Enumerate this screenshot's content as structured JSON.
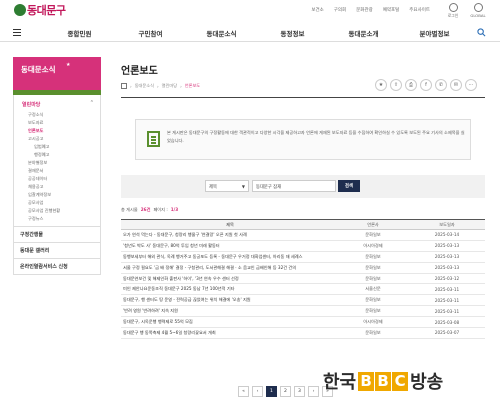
{
  "header": {
    "logo_text": "동대문구",
    "util_links": [
      "보건소",
      "구의회",
      "문화관광",
      "예약포털",
      "주요사이트"
    ],
    "util_icons": [
      {
        "name": "login-icon",
        "label": "로그인"
      },
      {
        "name": "global-icon",
        "label": "GLOBAL"
      }
    ]
  },
  "nav": {
    "items": [
      "종합민원",
      "구민참여",
      "동대문소식",
      "동정정보",
      "동대문소개",
      "분야별정보"
    ]
  },
  "sidebar": {
    "title": "동대문소식",
    "group": "열린마당",
    "links": [
      {
        "label": "구정소식",
        "active": false
      },
      {
        "label": "보도자료",
        "active": false
      },
      {
        "label": "언론보도",
        "active": true
      },
      {
        "label": "고시공고",
        "active": false
      }
    ],
    "sublinks": [
      "입법예고",
      "행정예고"
    ],
    "more_links": [
      "분야별정보",
      "결재문서",
      "공공데이터",
      "채용공고",
      "입찰계약정보",
      "공모사업",
      "공모사업 진행현황",
      "구정뉴스"
    ],
    "sections": [
      "구정간행물",
      "동대문 갤러리",
      "온라인열람서비스 신청"
    ]
  },
  "content": {
    "title": "언론보도",
    "breadcrumb": [
      "동대문소식",
      "열린마당",
      "언론보도"
    ],
    "tools": [
      "★",
      "⇪",
      "⎙",
      "f",
      "✆",
      "✉",
      "⋯"
    ],
    "notice": "본 게시판은 동대문구의 구정활동에 대한 객관적이고 다양한 시각을 제공하고자 언론에 게재된 보도자료 등을 수집하여 확인하실 수 있도록 보도된 주요 기사의 소제목을 실었습니다.",
    "search": {
      "select": "제목",
      "query": "동대문구 잠재",
      "button": "검색"
    },
    "count": {
      "label": "총 게시물",
      "total": "26건",
      "page_label": "페이지 :",
      "page": "1/3"
    },
    "columns": [
      "제목",
      "언론사",
      "보도일자"
    ],
    "rows": [
      {
        "title": "오가 연석 먹는다 - 동대문구, 청량리 행물구 '연결망' 오픈 지원 첫 사례",
        "dept": "문화일보",
        "date": "2025-03-14"
      },
      {
        "title": "'청년도 박도 사' 동대문구, 80억 투입 청년 미래 활동터",
        "dept": "아시아경제",
        "date": "2025-03-13"
      },
      {
        "title": "동행보세부터 해외 관식, 옥례 행거주고 동궁포도 등록 - 동대문구 우거정 대화업센터, 아리동 재 세례스",
        "dept": "문화일보",
        "date": "2025-03-13"
      },
      {
        "title": "서울 구정 필요도 '금 배 정해' 결정 - 구청관리, 도서관해결 해결 · 소 음교인 금배인해 등 32건 건의",
        "dept": "문화일보",
        "date": "2025-03-13"
      },
      {
        "title": "동대문연보건 및 해제인화 출판사 '하이', '3년 연속 우수 센터 선정",
        "dept": "문화일보",
        "date": "2025-03-12"
      },
      {
        "title": "미인 제안나요운동조직 동대문구 2025 동남 7년 100년적 기타",
        "dept": "서울신문",
        "date": "2025-03-11"
      },
      {
        "title": "동대문구, 행 센터도 땅 운영 - 전력공급 끊었여는 위치 해결에 '오송' 지원",
        "dept": "문화일보",
        "date": "2025-03-11"
      },
      {
        "title": "'반려 영원 '반려하려' 지속 지원",
        "dept": "문화일보",
        "date": "2025-03-11"
      },
      {
        "title": "동대문구, 시옥운행 행력제로 55억 모집",
        "dept": "아시아경제",
        "date": "2025-03-08"
      },
      {
        "title": "동대문구 행 동쪽축제 4월 5~6일 청량리꽃요서 개최",
        "dept": "문화일보",
        "date": "2025-03-07"
      }
    ],
    "pager": [
      "«",
      "‹",
      "1",
      "2",
      "3",
      "›",
      "»"
    ],
    "active_page": "1"
  },
  "watermark": {
    "pre": "한국",
    "bbc": [
      "B",
      "B",
      "C"
    ],
    "post": "방송"
  }
}
